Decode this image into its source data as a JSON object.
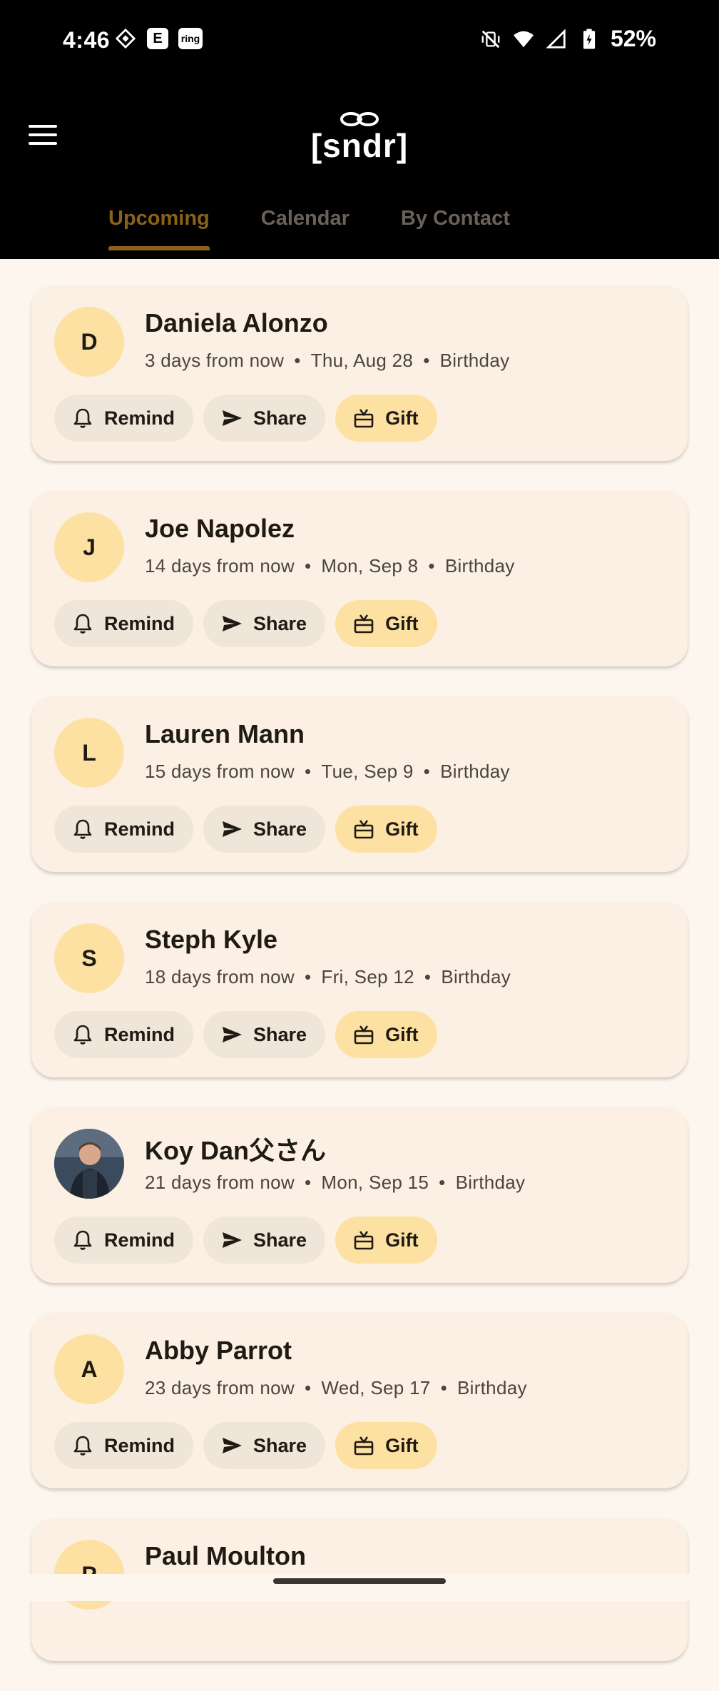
{
  "status_bar": {
    "time": "4:46",
    "ring_label": "ring",
    "battery": "52%"
  },
  "app": {
    "logo": "[sndr]",
    "tabs": [
      {
        "label": "Upcoming",
        "active": true
      },
      {
        "label": "Calendar",
        "active": false
      },
      {
        "label": "By Contact",
        "active": false
      }
    ]
  },
  "actions": {
    "remind": "Remind",
    "share": "Share",
    "gift": "Gift"
  },
  "events": [
    {
      "initial": "D",
      "name": "Daniela Alonzo",
      "relative": "3 days from now",
      "date": "Thu, Aug 28",
      "type": "Birthday"
    },
    {
      "initial": "J",
      "name": "Joe Napolez",
      "relative": "14 days from now",
      "date": "Mon, Sep 8",
      "type": "Birthday"
    },
    {
      "initial": "L",
      "name": "Lauren Mann",
      "relative": "15 days from now",
      "date": "Tue, Sep 9",
      "type": "Birthday"
    },
    {
      "initial": "S",
      "name": "Steph Kyle",
      "relative": "18 days from now",
      "date": "Fri, Sep 12",
      "type": "Birthday"
    },
    {
      "initial": "",
      "name": "Koy Dan父さん",
      "relative": "21 days from now",
      "date": "Mon, Sep 15",
      "type": "Birthday"
    },
    {
      "initial": "A",
      "name": "Abby Parrot",
      "relative": "23 days from now",
      "date": "Wed, Sep 17",
      "type": "Birthday"
    },
    {
      "initial": "P",
      "name": "Paul Moulton"
    }
  ],
  "colors": {
    "accent": "#8a6118",
    "avatar_bg": "#fde1a3",
    "card_bg": "#fbf0e3",
    "page_bg": "#fdf6ee"
  }
}
